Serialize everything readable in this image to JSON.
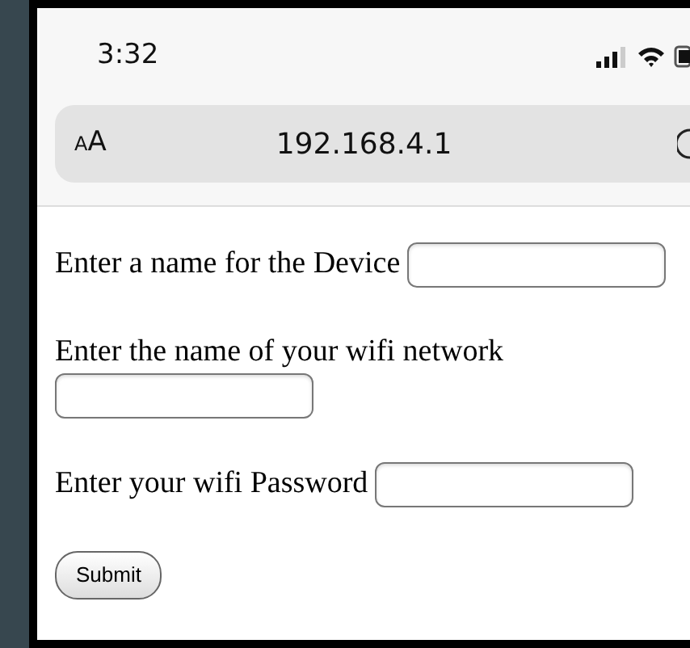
{
  "status_bar": {
    "time": "3:32"
  },
  "address_bar": {
    "text_size_button": "AA",
    "url": "192.168.4.1"
  },
  "form": {
    "fields": [
      {
        "label": "Enter a name for the Device"
      },
      {
        "label": "Enter the name of your wifi network"
      },
      {
        "label": "Enter your wifi Password"
      }
    ],
    "submit": "Submit"
  }
}
